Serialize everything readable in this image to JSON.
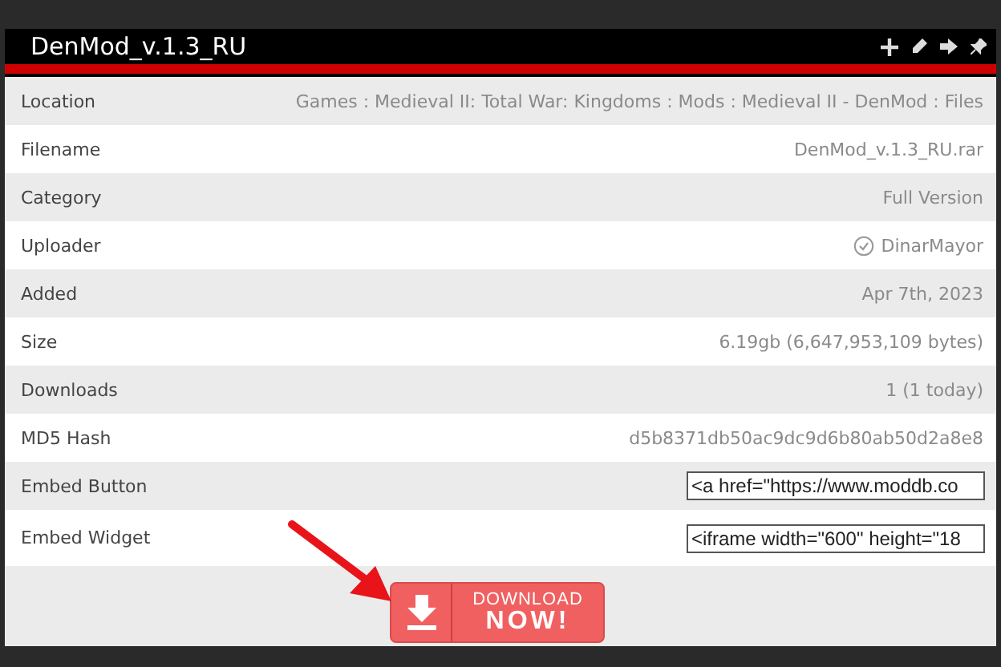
{
  "window": {
    "title": "DenMod_v.1.3_RU"
  },
  "rows": [
    {
      "kind": "text",
      "label": "Location",
      "value": "Games : Medieval II: Total War: Kingdoms : Mods : Medieval II - DenMod : Files"
    },
    {
      "kind": "text",
      "label": "Filename",
      "value": "DenMod_v.1.3_RU.rar"
    },
    {
      "kind": "text",
      "label": "Category",
      "value": "Full Version"
    },
    {
      "kind": "user",
      "label": "Uploader",
      "value": "DinarMayor"
    },
    {
      "kind": "text",
      "label": "Added",
      "value": "Apr 7th, 2023"
    },
    {
      "kind": "text",
      "label": "Size",
      "value": "6.19gb (6,647,953,109 bytes)"
    },
    {
      "kind": "text",
      "label": "Downloads",
      "value": "1 (1 today)"
    },
    {
      "kind": "text",
      "label": "MD5 Hash",
      "value": "d5b8371db50ac9dc9d6b80ab50d2a8e8"
    },
    {
      "kind": "field",
      "label": "Embed Button",
      "value": "<a href=\"https://www.moddb.co"
    },
    {
      "kind": "field",
      "label": "Embed Widget",
      "value": "<iframe width=\"600\" height=\"18"
    }
  ],
  "download": {
    "line1": "DOWNLOAD",
    "line2": "NOW!"
  }
}
